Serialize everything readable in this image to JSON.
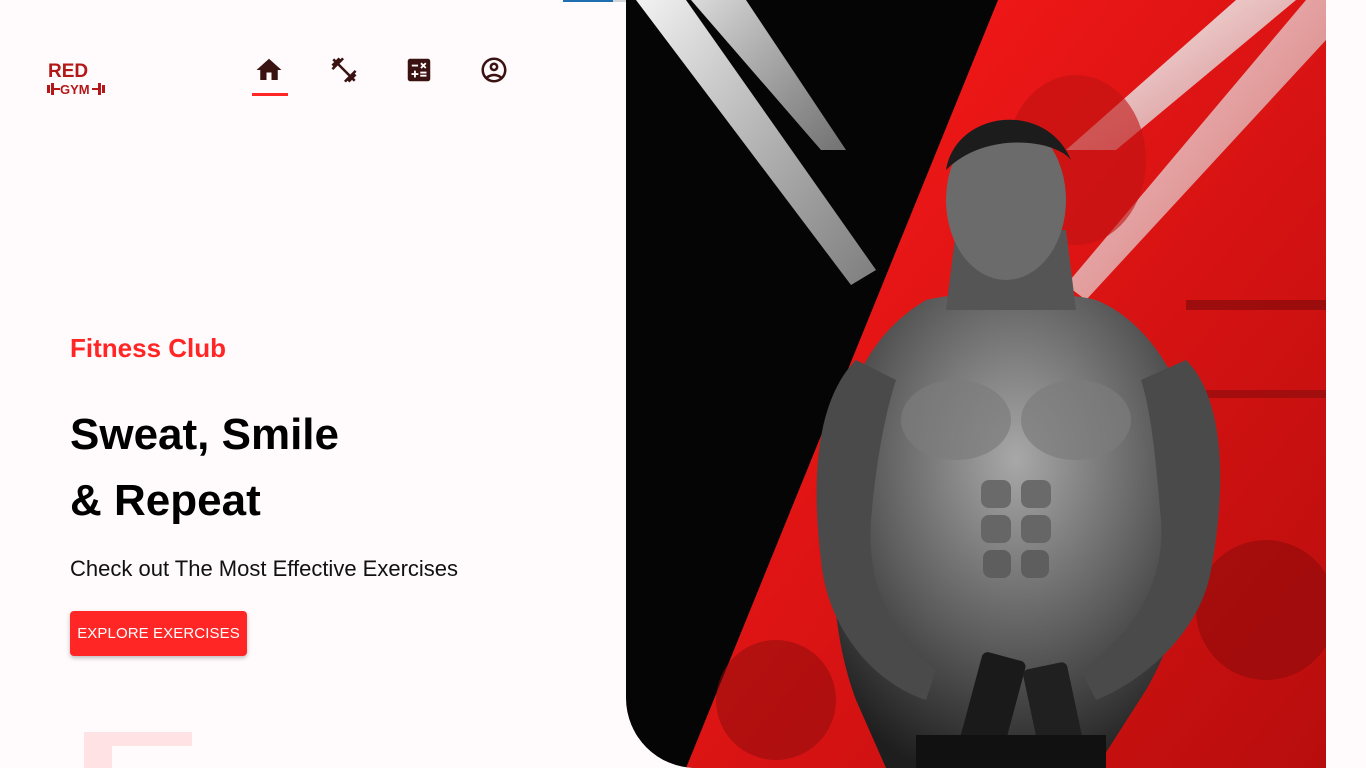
{
  "brand": {
    "logo_icon": "red-gym-logo",
    "accent": "#ff2625",
    "dark": "#3a1212",
    "background": "#fffafb"
  },
  "nav": {
    "items": [
      {
        "icon": "home-icon",
        "active": true
      },
      {
        "icon": "dumbbell-icon",
        "active": false
      },
      {
        "icon": "calculator-icon",
        "active": false
      },
      {
        "icon": "account-circle-icon",
        "active": false
      }
    ]
  },
  "hero": {
    "subtitle": "Fitness Club",
    "title_line1": "Sweat, Smile",
    "title_line2": "& Repeat",
    "description": "Check out The Most Effective Exercises",
    "cta_label": "EXPLORE EXERCISES",
    "image": "bodybuilder-banner-image"
  }
}
